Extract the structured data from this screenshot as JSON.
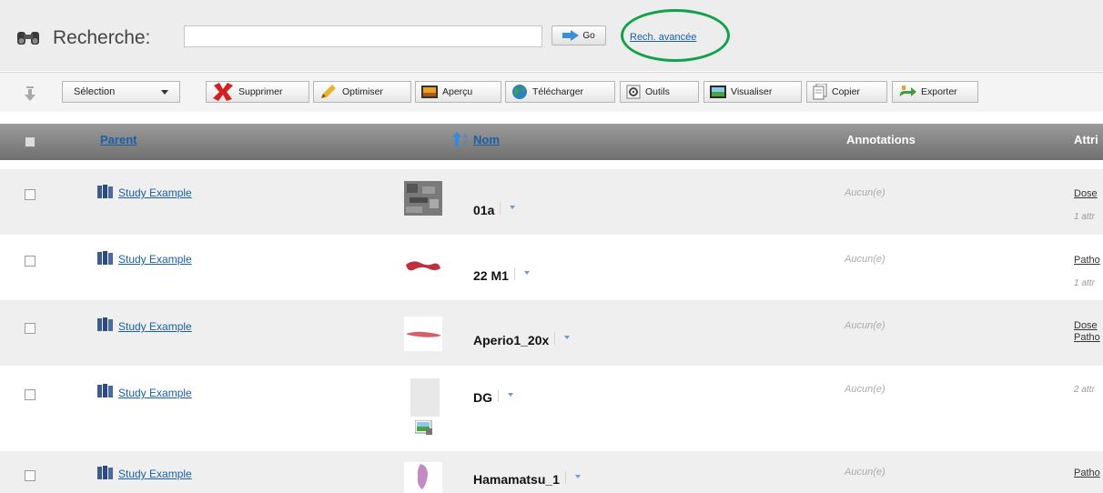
{
  "search": {
    "label": "Recherche:",
    "input_value": "",
    "go_label": "Go",
    "advanced_link": "Rech. avancée"
  },
  "toolbar": {
    "selection_label": "Sélection",
    "delete_label": "Supprimer",
    "optimize_label": "Optimiser",
    "preview_label": "Aperçu",
    "download_label": "Télécharger",
    "tools_label": "Outils",
    "view_label": "Visualiser",
    "copy_label": "Copier",
    "export_label": "Exporter"
  },
  "table": {
    "columns": {
      "parent": "Parent",
      "name": "Nom",
      "annotations": "Annotations",
      "attributes": "Attri"
    },
    "rows": [
      {
        "parent": "Study Example",
        "name": "01a",
        "annotations": "Aucun(e)",
        "attr_line1": "Dose",
        "attr_line2": "1 attr"
      },
      {
        "parent": "Study Example",
        "name": "22 M1",
        "annotations": "Aucun(e)",
        "attr_line1": "Patho",
        "attr_line2": "1 attr"
      },
      {
        "parent": "Study Example",
        "name": "Aperio1_20x",
        "annotations": "Aucun(e)",
        "attr_line1": "Dose",
        "attr_line2": "Patho"
      },
      {
        "parent": "Study Example",
        "name": "DG",
        "annotations": "Aucun(e)",
        "attr_line1": "2 attr",
        "attr_line2": ""
      },
      {
        "parent": "Study Example",
        "name": "Hamamatsu_1",
        "annotations": "Aucun(e)",
        "attr_line1": "Patho",
        "attr_line2": ""
      }
    ]
  },
  "colors": {
    "link": "#1a5fa8",
    "header_bg": "#7d7d7d",
    "highlight_ellipse": "#12a14b"
  },
  "icons": {
    "search": "binoculars-icon",
    "go": "arrow-right-icon",
    "parent": "study-book-icon",
    "sort": "sort-ascending-icon"
  }
}
